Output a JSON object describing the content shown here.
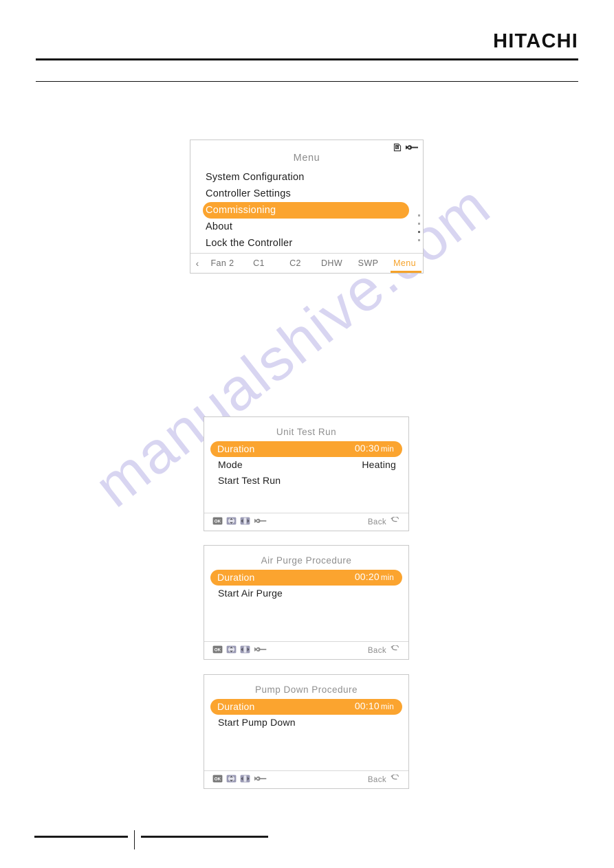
{
  "page": {
    "brand": "HITACHI"
  },
  "screens": {
    "menu": {
      "title": "Menu",
      "items": [
        {
          "label": "System Configuration",
          "selected": false
        },
        {
          "label": "Controller Settings",
          "selected": false
        },
        {
          "label": "Commissioning",
          "selected": true
        },
        {
          "label": "About",
          "selected": false
        },
        {
          "label": "Lock the Controller",
          "selected": false
        }
      ],
      "status_icons": [
        "sd-card-icon",
        "service-wrench-icon"
      ],
      "scroll_dots": 4,
      "scroll_active_index": 2,
      "tabs": [
        {
          "label": "Fan 2",
          "active": false
        },
        {
          "label": "C1",
          "active": false
        },
        {
          "label": "C2",
          "active": false
        },
        {
          "label": "DHW",
          "active": false
        },
        {
          "label": "SWP",
          "active": false
        },
        {
          "label": "Menu",
          "active": true
        }
      ],
      "prev_arrow": "‹"
    },
    "test_run": {
      "title": "Unit Test Run",
      "rows": [
        {
          "key": "Duration",
          "value": "00:30",
          "unit": "min",
          "selected": true
        },
        {
          "key": "Mode",
          "value": "Heating",
          "unit": "",
          "selected": false
        },
        {
          "key": "Start Test Run",
          "value": "",
          "unit": "",
          "selected": false
        }
      ],
      "footer_icons": [
        "ok-button-icon",
        "up-down-arrows-icon",
        "left-right-arrows-icon",
        "service-wrench-icon"
      ],
      "back_label": "Back"
    },
    "air_purge": {
      "title": "Air Purge Procedure",
      "rows": [
        {
          "key": "Duration",
          "value": "00:20",
          "unit": "min",
          "selected": true
        },
        {
          "key": "Start Air Purge",
          "value": "",
          "unit": "",
          "selected": false
        }
      ],
      "footer_icons": [
        "ok-button-icon",
        "up-down-arrows-icon",
        "left-right-arrows-icon",
        "service-wrench-icon"
      ],
      "back_label": "Back"
    },
    "pump_down": {
      "title": "Pump Down Procedure",
      "rows": [
        {
          "key": "Duration",
          "value": "00:10",
          "unit": "min",
          "selected": true
        },
        {
          "key": "Start Pump Down",
          "value": "",
          "unit": "",
          "selected": false
        }
      ],
      "footer_icons": [
        "ok-button-icon",
        "up-down-arrows-icon",
        "left-right-arrows-icon",
        "service-wrench-icon"
      ],
      "back_label": "Back"
    }
  },
  "watermark": {
    "text": "manualshive.com"
  },
  "colors": {
    "accent_orange": "#fba42f",
    "screen_title_gray": "#8c8c8c",
    "text_black": "#1d1d1d"
  }
}
